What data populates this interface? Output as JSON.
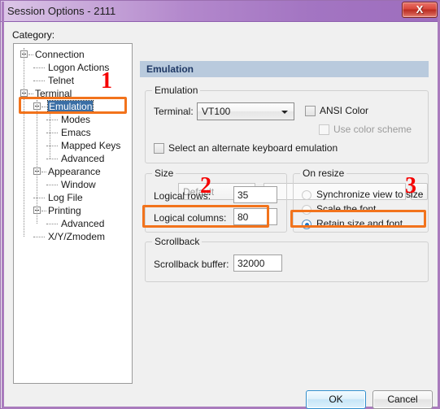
{
  "window": {
    "title": "Session Options - 2111",
    "close_label": "X"
  },
  "category": {
    "label": "Category:",
    "tree": [
      {
        "label": "Connection",
        "level": 0,
        "expandable": true,
        "selected": false
      },
      {
        "label": "Logon Actions",
        "level": 1,
        "expandable": false,
        "selected": false
      },
      {
        "label": "Telnet",
        "level": 1,
        "expandable": false,
        "selected": false
      },
      {
        "label": "Terminal",
        "level": 0,
        "expandable": true,
        "selected": false
      },
      {
        "label": "Emulation",
        "level": 1,
        "expandable": true,
        "selected": true
      },
      {
        "label": "Modes",
        "level": 2,
        "expandable": false,
        "selected": false
      },
      {
        "label": "Emacs",
        "level": 2,
        "expandable": false,
        "selected": false
      },
      {
        "label": "Mapped Keys",
        "level": 2,
        "expandable": false,
        "selected": false
      },
      {
        "label": "Advanced",
        "level": 2,
        "expandable": false,
        "selected": false
      },
      {
        "label": "Appearance",
        "level": 1,
        "expandable": true,
        "selected": false
      },
      {
        "label": "Window",
        "level": 2,
        "expandable": false,
        "selected": false
      },
      {
        "label": "Log File",
        "level": 1,
        "expandable": false,
        "selected": false
      },
      {
        "label": "Printing",
        "level": 1,
        "expandable": true,
        "selected": false
      },
      {
        "label": "Advanced",
        "level": 2,
        "expandable": false,
        "selected": false
      },
      {
        "label": "X/Y/Zmodem",
        "level": 1,
        "expandable": false,
        "selected": false
      }
    ]
  },
  "panel": {
    "header": "Emulation",
    "emulation_group": {
      "legend": "Emulation",
      "terminal_label": "Terminal:",
      "terminal_value": "VT100",
      "ansi_color_label": "ANSI Color",
      "ansi_color_checked": false,
      "use_color_scheme_label": "Use color scheme",
      "use_color_scheme_checked": false,
      "use_color_scheme_disabled": true,
      "alt_keyboard_label": "Select an alternate keyboard emulation",
      "alt_keyboard_checked": false,
      "alt_keyboard_combo_value": "Default",
      "alt_keyboard_combo_disabled": true,
      "alt_keyboard_text_value": "",
      "browse_label": "..."
    },
    "size_group": {
      "legend": "Size",
      "rows_label": "Logical rows:",
      "rows_value": "35",
      "cols_label": "Logical columns:",
      "cols_value": "80"
    },
    "resize_group": {
      "legend": "On resize",
      "options": [
        {
          "label": "Synchronize view to size",
          "selected": false
        },
        {
          "label": "Scale the font",
          "selected": false
        },
        {
          "label": "Retain size and font",
          "selected": true
        }
      ]
    },
    "scrollback_group": {
      "legend": "Scrollback",
      "buffer_label": "Scrollback buffer:",
      "buffer_value": "32000"
    }
  },
  "footer": {
    "ok_label": "OK",
    "cancel_label": "Cancel"
  },
  "annotations": {
    "numbers": [
      "1",
      "2",
      "3"
    ],
    "color": "#f50000",
    "box_color": "#f2731c"
  }
}
